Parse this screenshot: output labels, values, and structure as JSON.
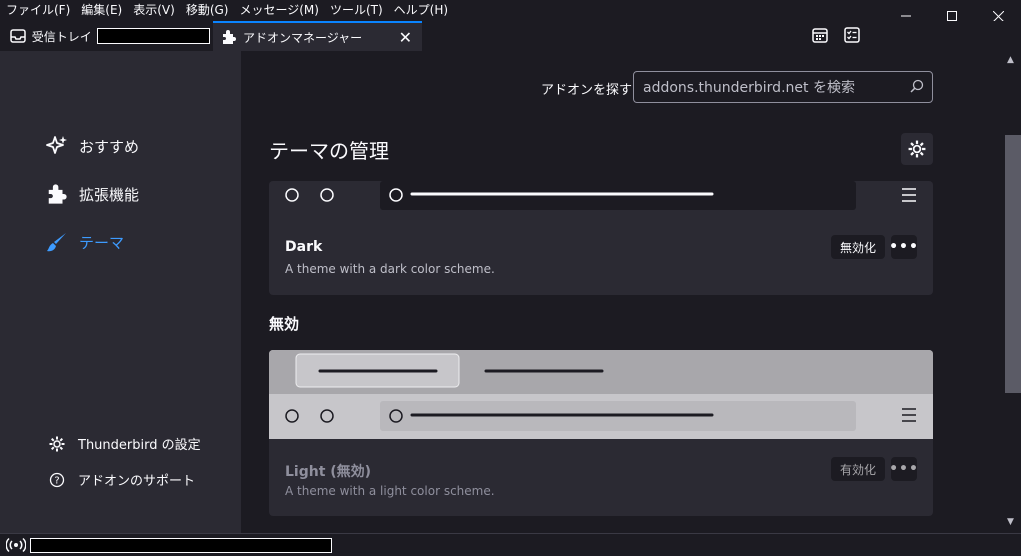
{
  "menu": [
    "ファイル(F)",
    "編集(E)",
    "表示(V)",
    "移動(G)",
    "メッセージ(M)",
    "ツール(T)",
    "ヘルプ(H)"
  ],
  "tabs": {
    "inbox": "受信トレイ",
    "addons": "アドオンマネージャー"
  },
  "sidebar": {
    "categories": [
      "おすすめ",
      "拡張機能",
      "テーマ"
    ],
    "footer": [
      "Thunderbird の設定",
      "アドオンのサポート"
    ]
  },
  "search": {
    "label": "アドオンを探す",
    "placeholder": "addons.thunderbird.net を検索"
  },
  "page": {
    "title": "テーマの管理",
    "disabled_section": "無効"
  },
  "themes": [
    {
      "name": "Dark",
      "description": "A theme with a dark color scheme.",
      "action": "無効化"
    },
    {
      "name": "Light (無効)",
      "description": "A theme with a light color scheme.",
      "action": "有効化"
    }
  ],
  "colors": {
    "accent": "#0a84ff",
    "sidebar_active": "#3d9bff",
    "background": "#1c1b22",
    "panel": "#2b2a33"
  }
}
